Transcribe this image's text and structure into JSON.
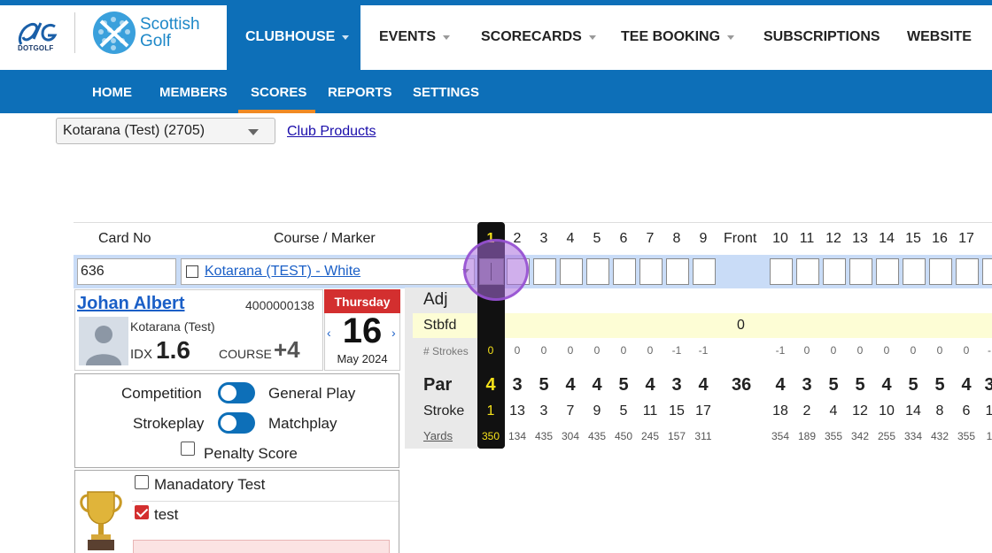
{
  "nav": {
    "logo_dotgolf": "DOTGOLF",
    "logo_scottish": "Scottish",
    "logo_golf": "Golf",
    "items": [
      {
        "label": "CLUBHOUSE",
        "dropdown": true,
        "active": true
      },
      {
        "label": "EVENTS",
        "dropdown": true
      },
      {
        "label": "SCORECARDS",
        "dropdown": true
      },
      {
        "label": "TEE BOOKING",
        "dropdown": true
      },
      {
        "label": "SUBSCRIPTIONS",
        "dropdown": false
      },
      {
        "label": "WEBSITE",
        "dropdown": false
      }
    ]
  },
  "subnav": {
    "items": [
      {
        "label": "HOME"
      },
      {
        "label": "MEMBERS"
      },
      {
        "label": "SCORES",
        "active": true
      },
      {
        "label": "REPORTS"
      },
      {
        "label": "SETTINGS"
      }
    ]
  },
  "club": {
    "selected": "Kotarana (Test) (2705)",
    "products_link": "Club Products"
  },
  "scorecard": {
    "card_no_label": "Card No",
    "course_marker_label": "Course / Marker",
    "card_no_value": "636",
    "course_value": "Kotarana (TEST) - White",
    "front_label": "Front",
    "holes": [
      "1",
      "2",
      "3",
      "4",
      "5",
      "6",
      "7",
      "8",
      "9",
      "10",
      "11",
      "12",
      "13",
      "14",
      "15",
      "16",
      "17"
    ],
    "current_hole": "1"
  },
  "player": {
    "name": "Johan Albert",
    "member_id": "4000000138",
    "club": "Kotarana (Test)",
    "idx_label": "IDX",
    "idx_value": "1.6",
    "course_label": "COURSE",
    "course_value": "+4"
  },
  "date": {
    "day": "Thursday",
    "num": "16",
    "month": "May 2024",
    "prev": "‹",
    "next": "›"
  },
  "rows": {
    "adj_label": "Adj",
    "stbfd_label": "Stbfd",
    "stbfd_total": "0",
    "strokes_label": "# Strokes",
    "par_label": "Par",
    "stroke_label": "Stroke",
    "yards_label": "Yards",
    "front_par": "36",
    "strokes_front": [
      "0",
      "0",
      "0",
      "0",
      "0",
      "0",
      "0",
      "-1",
      "-1"
    ],
    "strokes_back": [
      "-1",
      "0",
      "0",
      "0",
      "0",
      "0",
      "0",
      "0",
      "-"
    ],
    "par_front": [
      "4",
      "3",
      "5",
      "4",
      "4",
      "5",
      "4",
      "3",
      "4"
    ],
    "par_back": [
      "4",
      "3",
      "5",
      "5",
      "4",
      "5",
      "5",
      "4",
      "3"
    ],
    "stroke_front": [
      "1",
      "13",
      "3",
      "7",
      "9",
      "5",
      "11",
      "15",
      "17"
    ],
    "stroke_back": [
      "18",
      "2",
      "4",
      "12",
      "10",
      "14",
      "8",
      "6",
      "1"
    ],
    "yards_front": [
      "350",
      "134",
      "435",
      "304",
      "435",
      "450",
      "245",
      "157",
      "311"
    ],
    "yards_back": [
      "354",
      "189",
      "355",
      "342",
      "255",
      "334",
      "432",
      "355",
      "1"
    ]
  },
  "competition": {
    "competition_label": "Competition",
    "general_label": "General Play",
    "strokeplay_label": "Strokeplay",
    "matchplay_label": "Matchplay",
    "penalty_label": "Penalty Score"
  },
  "trophies": {
    "items": [
      {
        "label": "Manadatory Test",
        "checked": false
      },
      {
        "label": "test",
        "checked": true
      }
    ]
  },
  "colors": {
    "brand_blue": "#0d6fb8",
    "accent_orange": "#f08a24",
    "highlight_yellow": "#f6e21a"
  }
}
